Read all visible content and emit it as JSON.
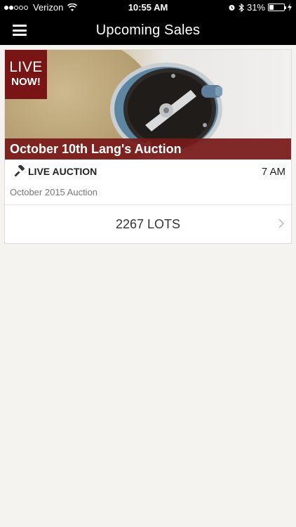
{
  "status_bar": {
    "carrier": "Verizon",
    "time": "10:55 AM",
    "battery": "31%",
    "battery_level": 0.31,
    "signal_bars_filled": 2,
    "signal_bars_total": 5
  },
  "nav": {
    "title": "Upcoming Sales",
    "menu_icon": "hamburger-menu-icon"
  },
  "sale": {
    "badge_line1": "LIVE",
    "badge_line2": "NOW!",
    "title": "October 10th Lang's Auction",
    "type_label": "LIVE AUCTION",
    "type_icon": "gavel-icon",
    "time": "7 AM",
    "description": "October 2015 Auction",
    "lots_label": "2267 LOTS"
  },
  "colors": {
    "accent": "#7a1515",
    "nav_bg": "#000000",
    "page_bg": "#f4f3ef"
  }
}
